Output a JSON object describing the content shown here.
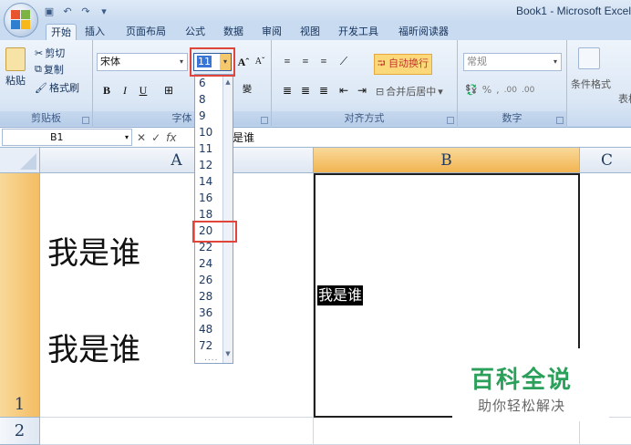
{
  "window": {
    "title": "Book1 - Microsoft Excel"
  },
  "tabs": [
    "开始",
    "插入",
    "页面布局",
    "公式",
    "数据",
    "审阅",
    "视图",
    "开发工具",
    "福昕阅读器"
  ],
  "clipboard": {
    "paste": "粘贴",
    "cut": "剪切",
    "copy": "复制",
    "format_painter": "格式刷",
    "label": "剪贴板"
  },
  "font": {
    "name": "宋体",
    "size": "11",
    "bold": "B",
    "italic": "I",
    "underline": "U",
    "label": "字体",
    "grow": "A",
    "shrink": "A"
  },
  "alignment": {
    "wrap_text": "自动换行",
    "merge_center": "合并后居中",
    "label": "对齐方式"
  },
  "number": {
    "format": "常规",
    "percent": "%",
    "label": "数字",
    "comma": ",",
    "dec_inc": ".00",
    "dec_dec": ".00"
  },
  "styles": {
    "conditional": "条件格式",
    "table": "表格"
  },
  "formula_bar": {
    "name_box": "B1",
    "fx": "fx",
    "content": "是谁"
  },
  "columns": [
    "A",
    "B",
    "C"
  ],
  "rows": [
    "1",
    "2"
  ],
  "cells": {
    "A1_line1": "我是谁",
    "A1_line2": "我是谁",
    "B1": "我是谁"
  },
  "font_size_options": [
    "6",
    "8",
    "9",
    "10",
    "11",
    "12",
    "14",
    "16",
    "18",
    "20",
    "22",
    "24",
    "26",
    "28",
    "36",
    "48",
    "72"
  ],
  "highlighted_size": "20",
  "watermark": {
    "title": "百科全说",
    "subtitle": "助你轻松解决"
  },
  "colors": {
    "selected_header": "#f2b451",
    "highlight_box": "#e0453a",
    "watermark_green": "#2aa05a"
  }
}
